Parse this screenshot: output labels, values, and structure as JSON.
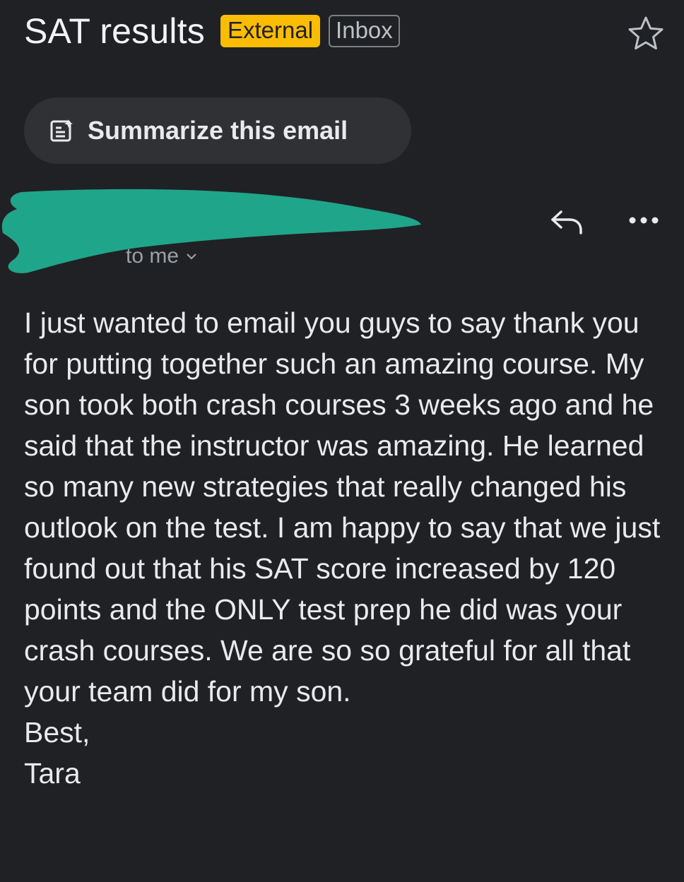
{
  "email": {
    "subject": "SAT results",
    "labels": {
      "external": "External",
      "inbox": "Inbox"
    },
    "summarize_label": "Summarize this email",
    "recipient_line": "to me",
    "body": "I just wanted to email you guys to say thank you for putting together such an amazing course. My son took both crash courses 3 weeks ago and he said that the instructor was amazing. He learned so many new strategies that really changed his outlook on the test. I am happy to say that we just found out that his SAT score increased by 120 points and the ONLY test prep he did was your crash courses. We are so so grateful for all that your team did for my son.",
    "signoff": "Best,",
    "signature": "Tara"
  },
  "colors": {
    "background": "#202124",
    "external_badge": "#fbbc04",
    "summarize_chip": "#303134",
    "redaction": "#1fa58a"
  },
  "icons": {
    "star": "star-outline-icon",
    "summarize": "summarize-document-icon",
    "reply": "reply-arrow-icon",
    "more": "more-horizontal-icon",
    "chevron": "chevron-down-icon"
  }
}
